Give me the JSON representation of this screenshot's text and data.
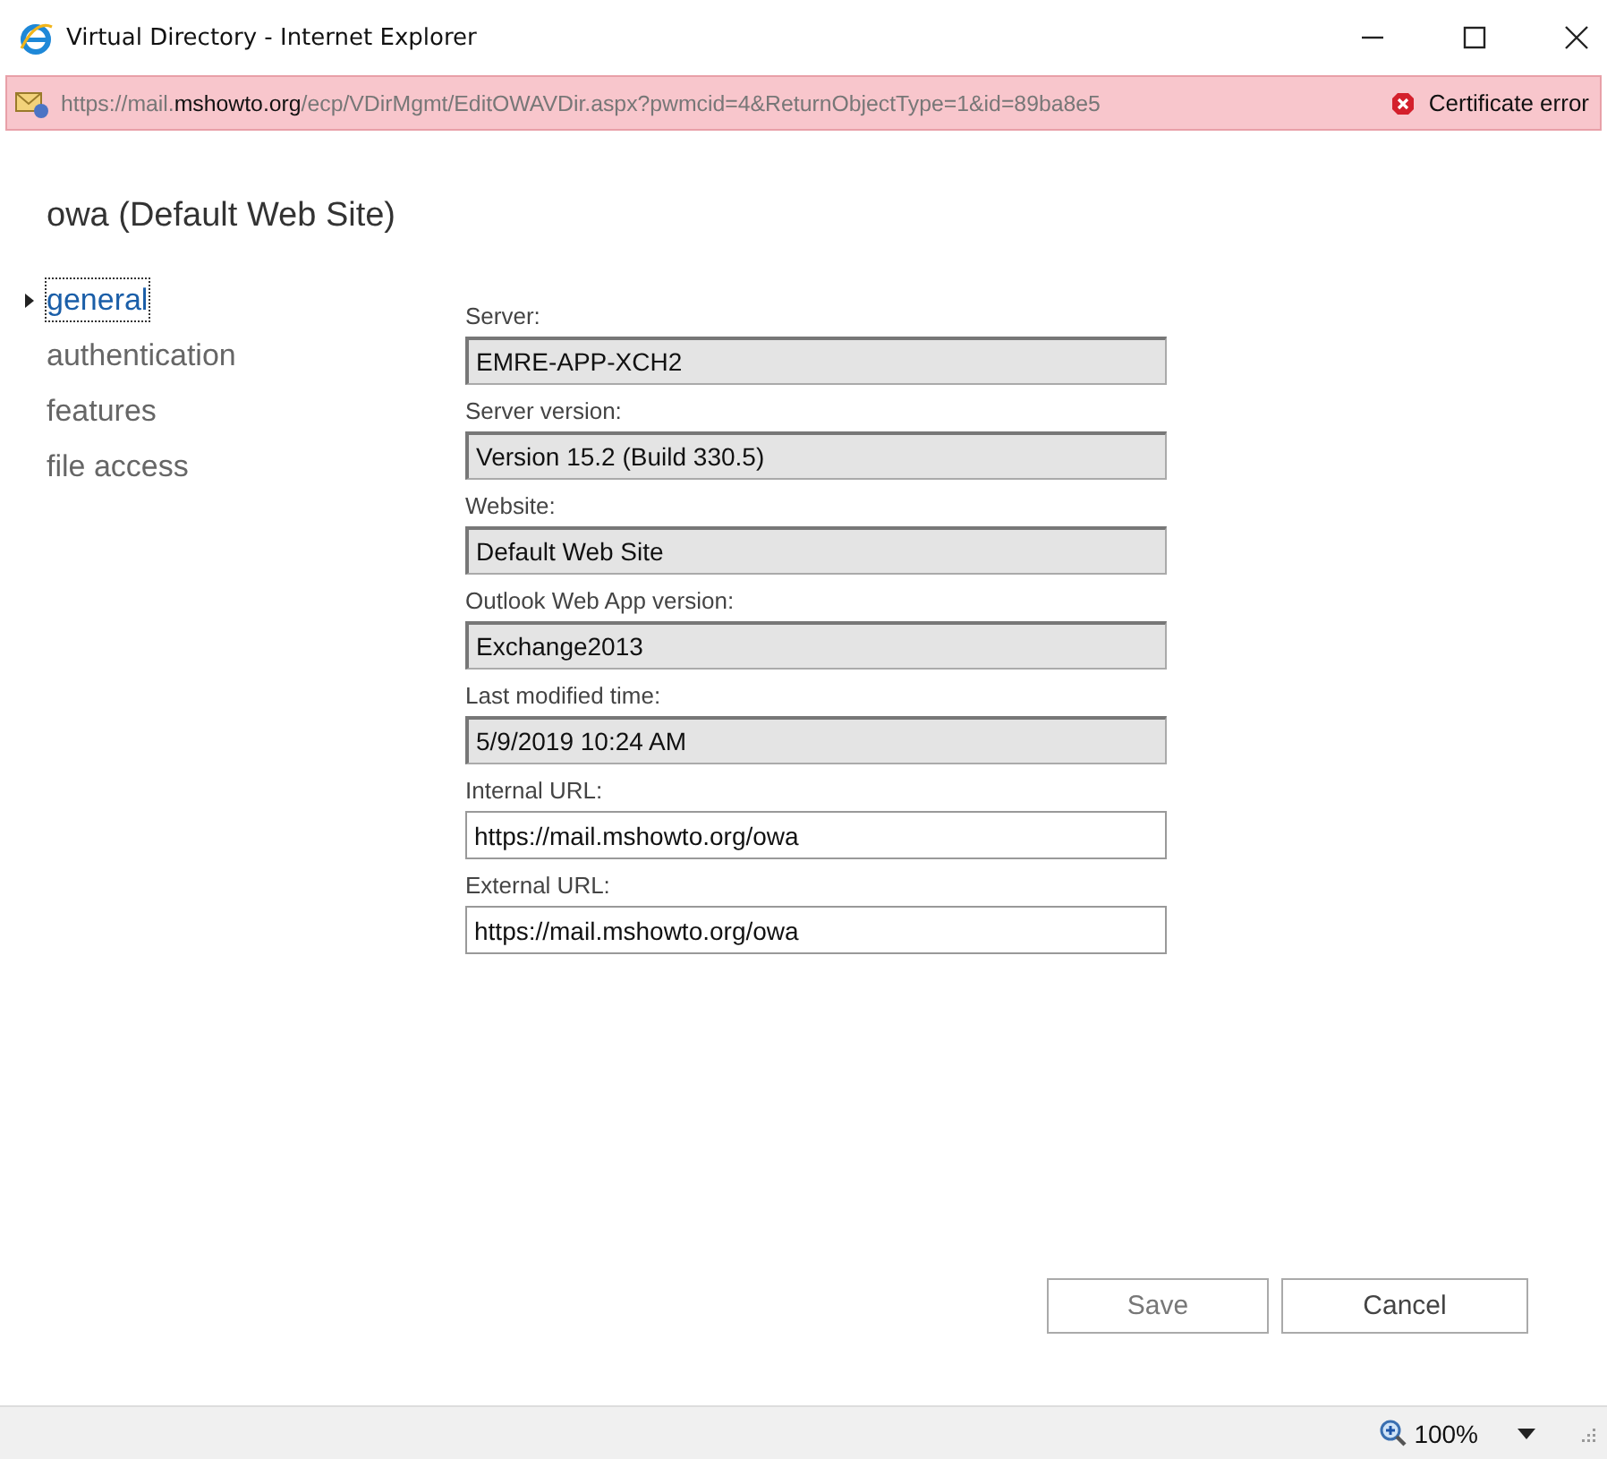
{
  "window": {
    "title": "Virtual Directory - Internet Explorer"
  },
  "address_bar": {
    "url": "https://mail.**mshowto.org**/ecp/VDirMgmt/EditOWAVDir.aspx?pwmcid=4&ReturnObjectType=1&id=89ba8e5",
    "certificate_status": "Certificate error"
  },
  "page_title": "owa (Default Web Site)",
  "nav": [
    {
      "label": "general",
      "selected": true
    },
    {
      "label": "authentication",
      "selected": false
    },
    {
      "label": "features",
      "selected": false
    },
    {
      "label": "file access",
      "selected": false
    }
  ],
  "fields": [
    {
      "label": "Server:",
      "value": "EMRE-APP-XCH2",
      "disabled": true
    },
    {
      "label": "Server version:",
      "value": "Version 15.2 (Build 330.5)",
      "disabled": true
    },
    {
      "label": "Website:",
      "value": "Default Web Site",
      "disabled": true
    },
    {
      "label": "Outlook Web App version:",
      "value": "Exchange2013",
      "disabled": true
    },
    {
      "label": "Last modified time:",
      "value": "5/9/2019 10:24 AM",
      "disabled": true
    },
    {
      "label": "Internal URL:",
      "value": "https://mail.mshowto.org/owa",
      "disabled": false
    },
    {
      "label": "External URL:",
      "value": "https://mail.mshowto.org/owa",
      "disabled": false
    }
  ],
  "buttons": [
    "Save",
    "Cancel"
  ],
  "status_bar": {
    "zoom": "100%"
  }
}
